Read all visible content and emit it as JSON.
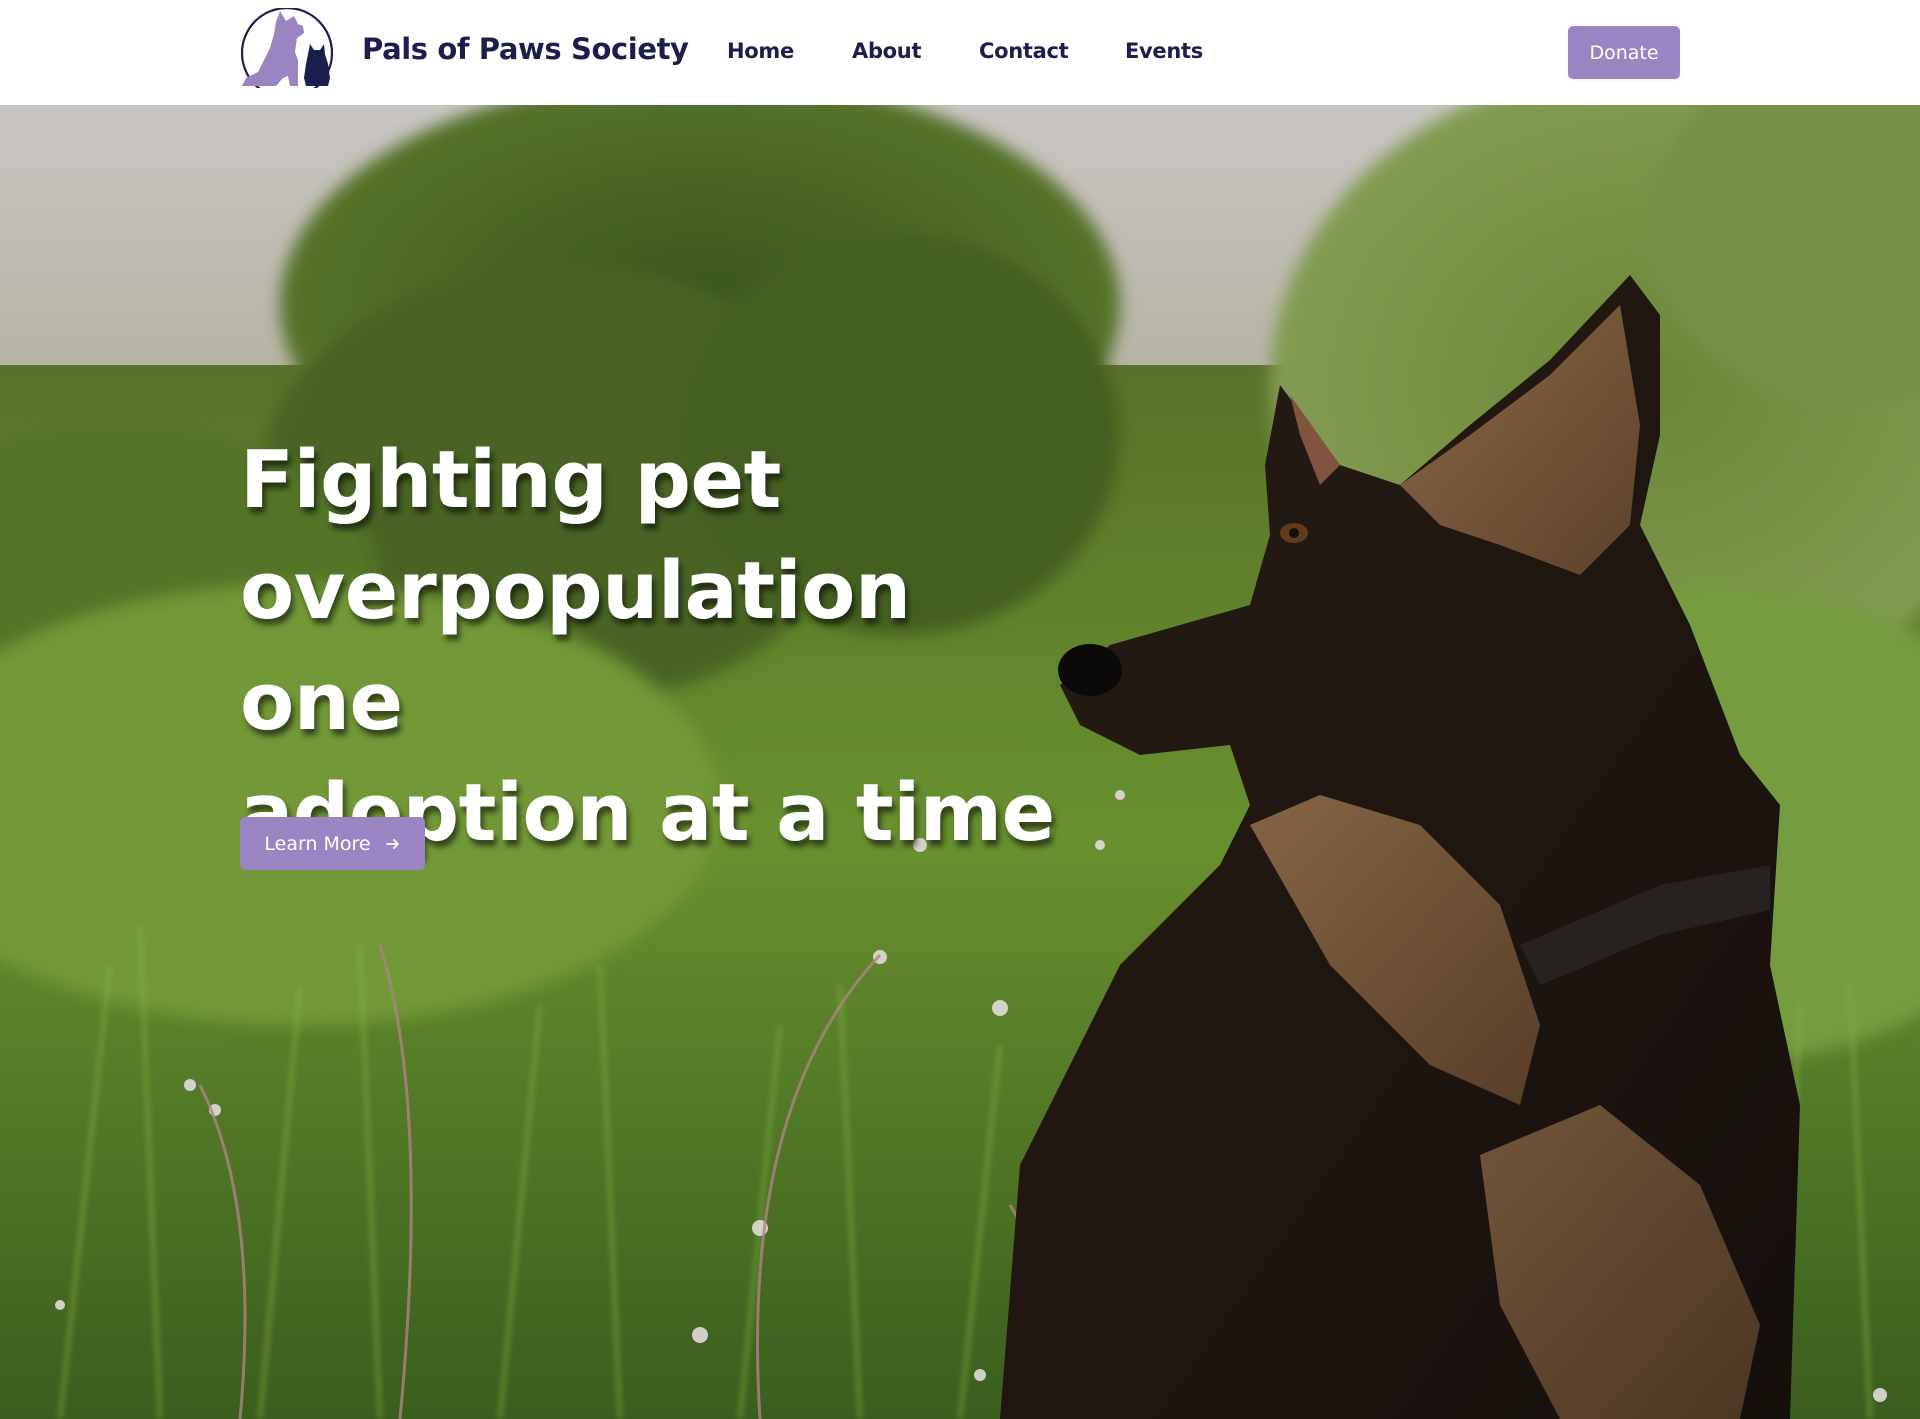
{
  "brand": {
    "name": "Pals of Paws Society",
    "logo_icon": "dog-and-cat-silhouette-icon",
    "logo_color": "#9b84c2",
    "logo_accent": "#1b1f4d"
  },
  "nav": {
    "items": [
      {
        "label": "Home"
      },
      {
        "label": "About"
      },
      {
        "label": "Contact"
      },
      {
        "label": "Events"
      }
    ],
    "donate_label": "Donate"
  },
  "hero": {
    "title_lines": [
      "Fighting pet",
      "overpopulation one",
      "adoption at a time"
    ],
    "cta_label": "Learn More",
    "cta_icon": "arrow-right-icon",
    "background_image": "German shepherd dog sitting in a grassy meadow with wildflowers at sunset"
  },
  "colors": {
    "accent": "#9b84c2",
    "text_dark": "#1b1f4d",
    "white": "#ffffff"
  }
}
